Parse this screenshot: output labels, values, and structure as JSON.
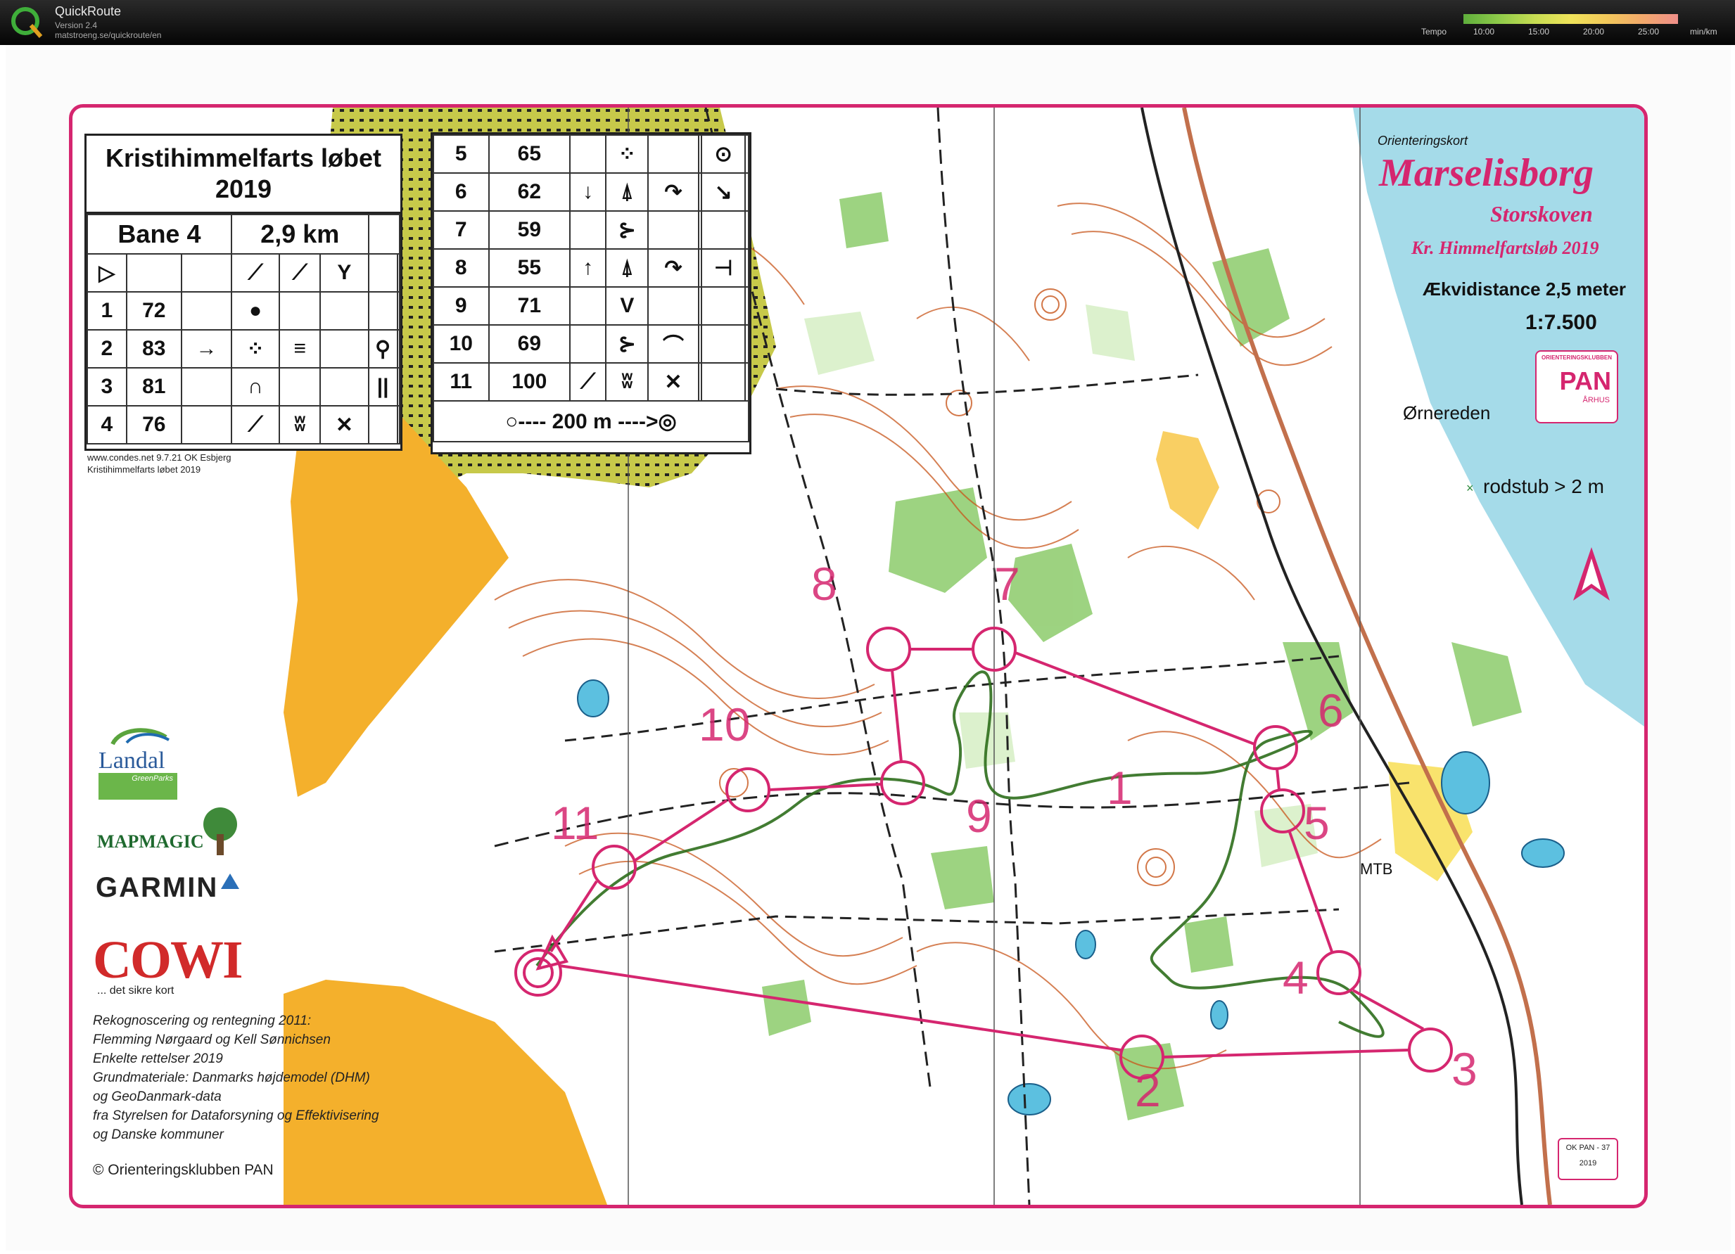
{
  "app": {
    "name": "QuickRoute",
    "version": "Version 2.4",
    "url": "matstroeng.se/quickroute/en",
    "legend_label": "Tempo",
    "legend_ticks": [
      "10:00",
      "15:00",
      "20:00",
      "25:00"
    ],
    "legend_unit": "min/km"
  },
  "event": {
    "title": "Kristihimmelfarts løbet 2019",
    "course": "Bane 4",
    "length": "2,9 km",
    "scale_line": "○---- 200 m ---->◎",
    "credit_line1": "www.condes.net 9.7.21 OK Esbjerg",
    "credit_line2": "Kristihimmelfarts løbet 2019"
  },
  "controls_left": [
    {
      "num": "1",
      "code": "72",
      "sym": [
        "",
        "●",
        "",
        "",
        "",
        ""
      ]
    },
    {
      "num": "2",
      "code": "83",
      "sym": [
        "→",
        "⁘",
        "≡",
        "",
        "⚲",
        ""
      ]
    },
    {
      "num": "3",
      "code": "81",
      "sym": [
        "",
        "∩",
        "",
        "",
        "||",
        ""
      ]
    },
    {
      "num": "4",
      "code": "76",
      "sym": [
        "",
        "⟋",
        "ʬ",
        "✕",
        "",
        ""
      ]
    }
  ],
  "start_row": [
    "▷",
    "",
    "",
    "⟋",
    "⟋",
    "Y",
    "",
    ""
  ],
  "controls_right": [
    {
      "num": "5",
      "code": "65",
      "sym": [
        "",
        "⁘",
        "",
        "",
        "⊙",
        ""
      ]
    },
    {
      "num": "6",
      "code": "62",
      "sym": [
        "↓",
        "⍋",
        "↷",
        "",
        "↘",
        ""
      ]
    },
    {
      "num": "7",
      "code": "59",
      "sym": [
        "",
        "⊱",
        "",
        "",
        "",
        ""
      ]
    },
    {
      "num": "8",
      "code": "55",
      "sym": [
        "↑",
        "⍋",
        "↷",
        "",
        "⊣",
        ""
      ]
    },
    {
      "num": "9",
      "code": "71",
      "sym": [
        "",
        "V",
        "",
        "",
        "",
        ""
      ]
    },
    {
      "num": "10",
      "code": "69",
      "sym": [
        "",
        "⊱",
        "⌒",
        "",
        "",
        ""
      ]
    },
    {
      "num": "11",
      "code": "100",
      "sym": [
        "⟋",
        "ʬ",
        "✕",
        "",
        "",
        ""
      ]
    }
  ],
  "map_panel": {
    "small": "Orienteringskort",
    "name": "Marselisborg",
    "sub": "Storskoven",
    "event_sub": "Kr. Himmelfartsløb 2019",
    "equidistance": "Ækvidistance 2,5 meter",
    "scale": "1:7.500",
    "place": "Ørnereden",
    "legend_rodstub": "rodstub > 2 m",
    "pan_top": "ORIENTERINGSKLUBBEN",
    "pan": "PAN",
    "pan_sub": "ÅRHUS",
    "badge_top": "OK PAN - 37",
    "badge_year": "2019"
  },
  "sponsors": {
    "landal": "Landal",
    "landal_sub": "GreenParks",
    "mapmagic": "MAPMAGIC",
    "garmin": "GARMIN",
    "cowi": "COWI",
    "cowi_tag": "... det sikre kort"
  },
  "credits": [
    "Rekognoscering og rentegning 2011:",
    "Flemming Nørgaard og Kell Sønnichsen",
    "Enkelte rettelser 2019",
    "Grundmateriale: Danmarks højdemodel (DHM)",
    "og GeoDanmark-data",
    "fra Styrelsen for Dataforsyning og Effektivisering",
    "og Danske kommuner"
  ],
  "copyright": "© Orienteringsklubben PAN",
  "map_labels": {
    "c1": "1",
    "c2": "2",
    "c3": "3",
    "c4": "4",
    "c5": "5",
    "c6": "6",
    "c7": "7",
    "c8": "8",
    "c9": "9",
    "c10": "10",
    "c11": "11",
    "mtb": "MTB"
  },
  "colors": {
    "course": "#d5266f",
    "forest_white": "#ffffff",
    "green": "#7fc361",
    "yellow": "#f7b32b",
    "contour": "#c8561b",
    "water": "#8fd3e8",
    "olive": "#9aa83a"
  }
}
